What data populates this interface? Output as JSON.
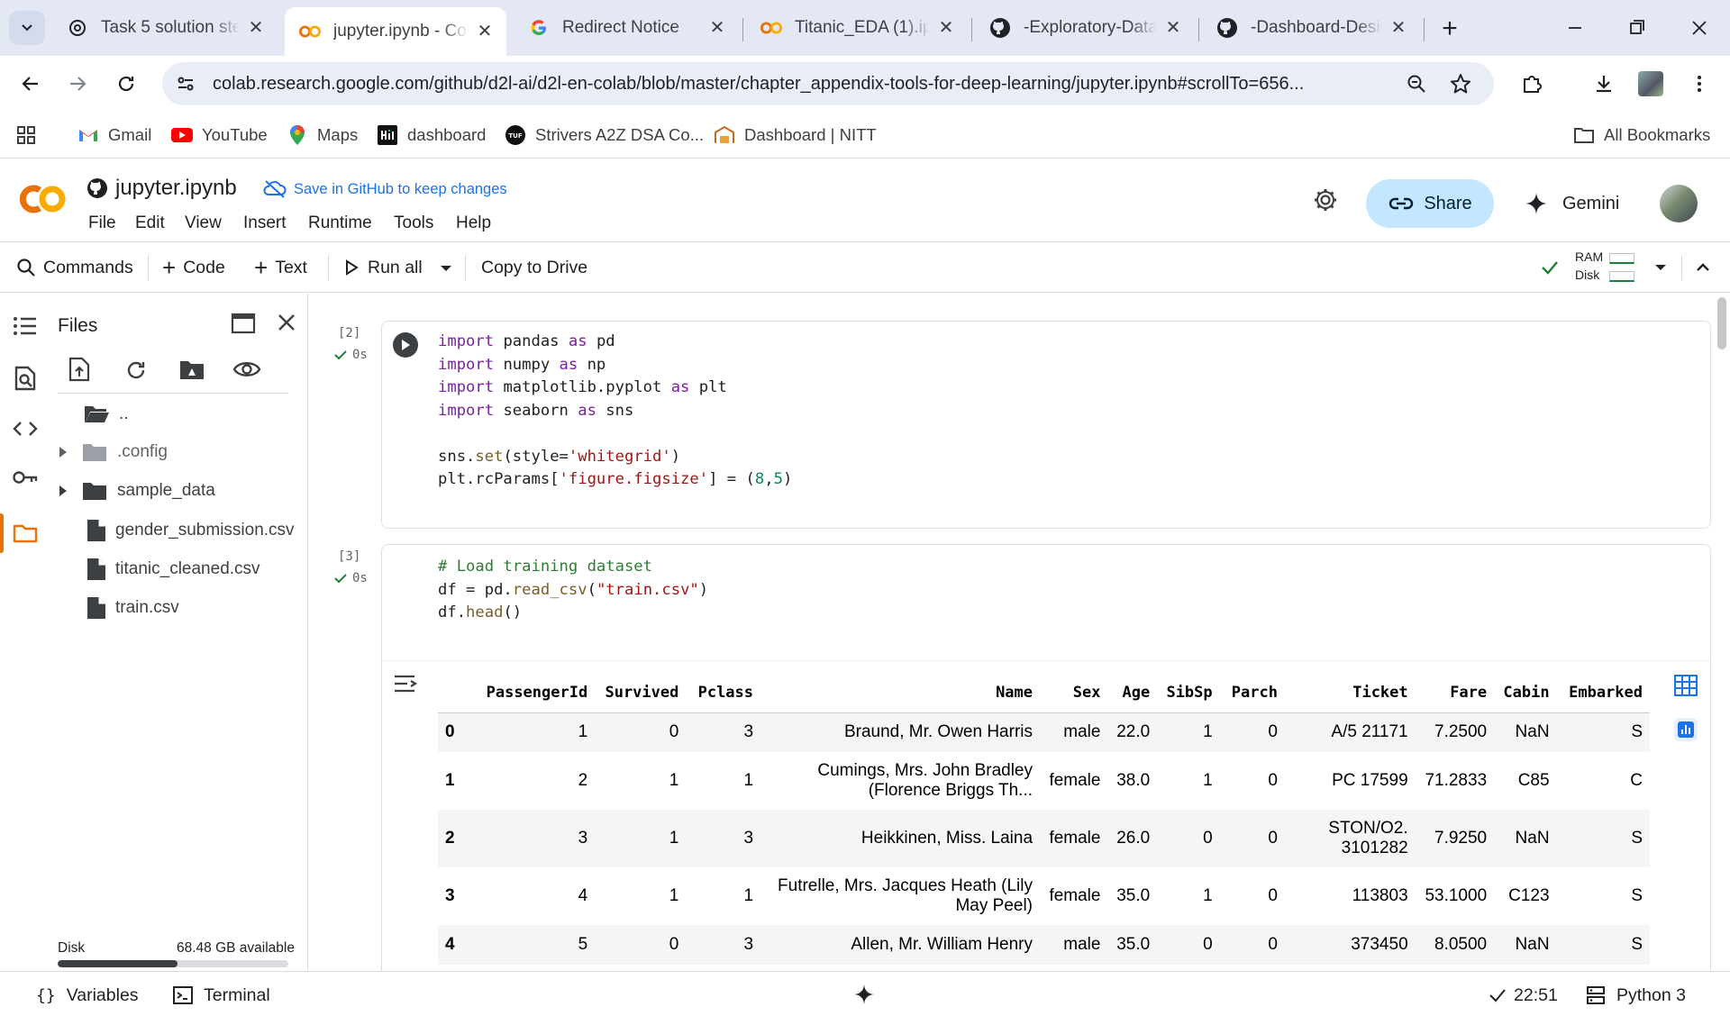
{
  "browser": {
    "tabs": [
      {
        "title": "Task 5 solution ste",
        "icon": "openai-icon",
        "active": false
      },
      {
        "title": "jupyter.ipynb - Col",
        "icon": "colab-icon",
        "active": true
      },
      {
        "title": "Redirect Notice",
        "icon": "google-icon",
        "active": false
      },
      {
        "title": "Titanic_EDA (1).ipy",
        "icon": "colab-icon",
        "active": false
      },
      {
        "title": "-Exploratory-Data-",
        "icon": "github-icon",
        "active": false
      },
      {
        "title": "-Dashboard-Desig",
        "icon": "github-icon",
        "active": false
      }
    ],
    "url": "colab.research.google.com/github/d2l-ai/d2l-en-colab/blob/master/chapter_appendix-tools-for-deep-learning/jupyter.ipynb#scrollTo=656...",
    "bookmarks": [
      {
        "label": "Gmail",
        "icon": "gmail-icon"
      },
      {
        "label": "YouTube",
        "icon": "youtube-icon"
      },
      {
        "label": "Maps",
        "icon": "maps-icon"
      },
      {
        "label": "dashboard",
        "icon": "dashboard-icon"
      },
      {
        "label": "Strivers A2Z DSA Co...",
        "icon": "tuf-icon"
      },
      {
        "label": "Dashboard | NITT",
        "icon": "nitt-icon"
      }
    ],
    "all_bookmarks": "All Bookmarks"
  },
  "colab": {
    "notebook_name": "jupyter.ipynb",
    "save_hint": "Save in GitHub to keep changes",
    "menu": [
      "File",
      "Edit",
      "View",
      "Insert",
      "Runtime",
      "Tools",
      "Help"
    ],
    "share_label": "Share",
    "gemini_label": "Gemini",
    "toolbar": {
      "commands": "Commands",
      "code": "Code",
      "text": "Text",
      "run_all": "Run all",
      "copy_to_drive": "Copy to Drive",
      "ram": "RAM",
      "disk": "Disk"
    },
    "accent": "#1a73e8",
    "share_bg": "#c2e7ff"
  },
  "files_panel": {
    "title": "Files",
    "items": [
      {
        "name": "..",
        "type": "parent"
      },
      {
        "name": ".config",
        "type": "folder"
      },
      {
        "name": "sample_data",
        "type": "folder"
      },
      {
        "name": "gender_submission.csv",
        "type": "file"
      },
      {
        "name": "titanic_cleaned.csv",
        "type": "file"
      },
      {
        "name": "train.csv",
        "type": "file"
      }
    ],
    "disk_label": "Disk",
    "disk_available": "68.48 GB available",
    "disk_used_fraction": 0.52
  },
  "cells": [
    {
      "exec_count": "[2]",
      "duration": "0s"
    },
    {
      "exec_count": "[3]",
      "duration": "0s"
    }
  ],
  "dataframe": {
    "columns": [
      "",
      "PassengerId",
      "Survived",
      "Pclass",
      "Name",
      "Sex",
      "Age",
      "SibSp",
      "Parch",
      "Ticket",
      "Fare",
      "Cabin",
      "Embarked"
    ],
    "rows": [
      [
        "0",
        "1",
        "0",
        "3",
        "Braund, Mr. Owen Harris",
        "male",
        "22.0",
        "1",
        "0",
        "A/5 21171",
        "7.2500",
        "NaN",
        "S"
      ],
      [
        "1",
        "2",
        "1",
        "1",
        "Cumings, Mrs. John Bradley (Florence Briggs Th...",
        "female",
        "38.0",
        "1",
        "0",
        "PC 17599",
        "71.2833",
        "C85",
        "C"
      ],
      [
        "2",
        "3",
        "1",
        "3",
        "Heikkinen, Miss. Laina",
        "female",
        "26.0",
        "0",
        "0",
        "STON/O2. 3101282",
        "7.9250",
        "NaN",
        "S"
      ],
      [
        "3",
        "4",
        "1",
        "1",
        "Futrelle, Mrs. Jacques Heath (Lily May Peel)",
        "female",
        "35.0",
        "1",
        "0",
        "113803",
        "53.1000",
        "C123",
        "S"
      ],
      [
        "4",
        "5",
        "0",
        "3",
        "Allen, Mr. William Henry",
        "male",
        "35.0",
        "0",
        "0",
        "373450",
        "8.0500",
        "NaN",
        "S"
      ]
    ]
  },
  "statusbar": {
    "variables": "Variables",
    "terminal": "Terminal",
    "time": "22:51",
    "kernel": "Python 3"
  }
}
